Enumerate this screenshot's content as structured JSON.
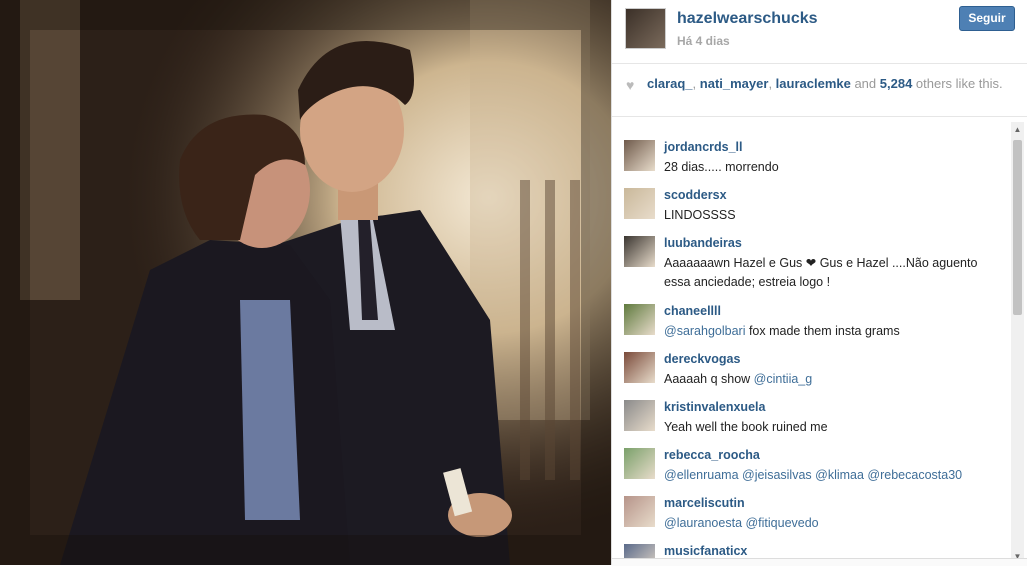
{
  "post": {
    "username": "hazelwearschucks",
    "time": "Há 4 dias",
    "follow_label": "Seguir",
    "photo_alt_icon": "photo"
  },
  "likes": {
    "users": [
      "claraq_",
      "nati_mayer",
      "lauraclemke"
    ],
    "sep1": ", ",
    "sep2": ", ",
    "and_text": " and ",
    "count": "5,284",
    "suffix": " others like this."
  },
  "comments": [
    {
      "user": "jordancrds_ll",
      "text": "28 dias..... morrendo",
      "avatar_color": "#6f5a4b"
    },
    {
      "user": "scoddersx",
      "text": "LINDOSSSS",
      "avatar_color": "#c9b89a"
    },
    {
      "user": "luubandeiras",
      "text": "Aaaaaaawn Hazel e Gus ❤ Gus e Hazel ....Não aguento essa anciedade; estreia logo !",
      "avatar_color": "#3a3530"
    },
    {
      "user": "chaneellll",
      "pre": "",
      "mention": "@sarahgolbari",
      "post": " fox made them insta grams",
      "avatar_color": "#5f7a3e"
    },
    {
      "user": "dereckvogas",
      "pre": "Aaaaah q show ",
      "mention": "@cintiia_g",
      "post": "",
      "avatar_color": "#7a4a3a"
    },
    {
      "user": "kristinvalenxuela",
      "text": "Yeah well the book ruined me",
      "avatar_color": "#8a8a8a"
    },
    {
      "user": "rebecca_roocha",
      "pre": "",
      "mention": "@ellenruama @jeisasilvas @klimaa @rebecacosta30",
      "post": "",
      "avatar_color": "#7aa06a"
    },
    {
      "user": "marceliscutin",
      "pre": "",
      "mention": "@lauranoesta @fitiquevedo",
      "post": "",
      "avatar_color": "#b6948a"
    },
    {
      "user": "musicfanaticx",
      "text": "",
      "avatar_color": "#5a6a8a"
    }
  ]
}
